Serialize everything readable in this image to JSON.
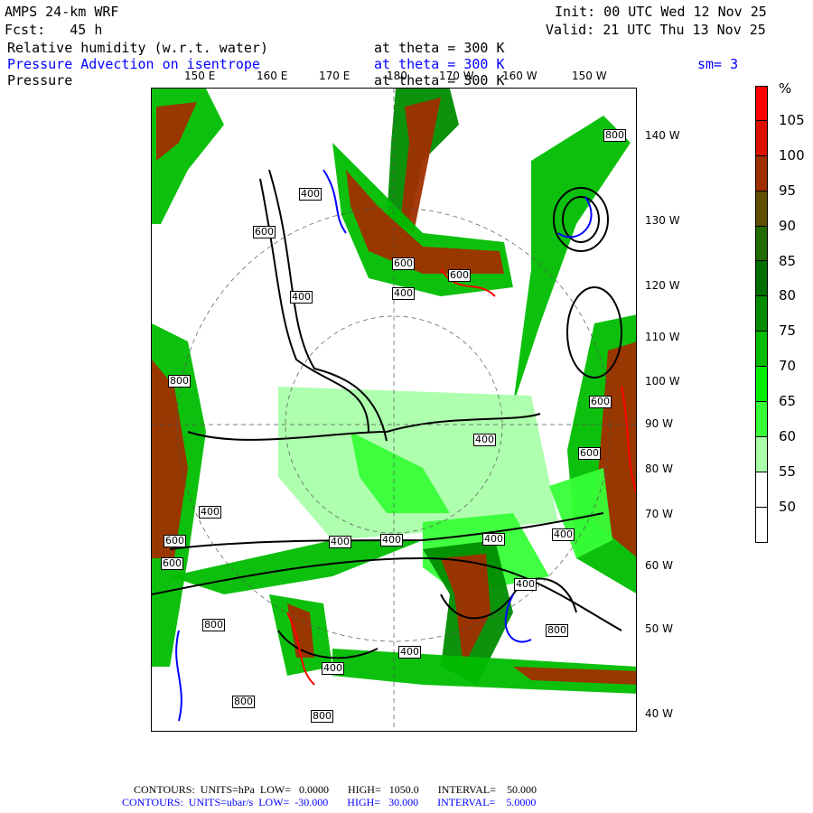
{
  "header": {
    "model": "AMPS 24-km WRF",
    "fcst": "Fcst:   45 h",
    "init": "Init: 00 UTC Wed 12 Nov 25",
    "valid": "Valid: 21 UTC Thu 13 Nov 25",
    "field1": "Relative humidity (w.r.t. water)",
    "field1_level": "at theta = 300 K",
    "field2": "Pressure Advection on isentrope",
    "field2_level": "at theta = 300 K",
    "smoothing": "sm= 3",
    "field3": "Pressure",
    "field3_level": "at theta = 300 K"
  },
  "map": {
    "top_lon_labels": [
      "150 E",
      "160 E",
      "170 E",
      "180",
      "170 W",
      "160 W",
      "150 W"
    ],
    "right_lon_labels": [
      "140 W",
      "130 W",
      "120 W",
      "110 W",
      "100 W",
      "90 W",
      "80 W",
      "70 W",
      "60 W",
      "50 W",
      "40 W"
    ],
    "contour_labels": [
      "800",
      "400",
      "600",
      "600",
      "600",
      "400",
      "400",
      "800",
      "600",
      "400",
      "600",
      "400",
      "600",
      "600",
      "400",
      "400",
      "400",
      "400",
      "400",
      "800",
      "800",
      "400",
      "400",
      "800",
      "800"
    ]
  },
  "colorbar": {
    "unit": "%",
    "labels": [
      "105",
      "100",
      "95",
      "90",
      "85",
      "80",
      "75",
      "70",
      "65",
      "60",
      "55",
      "50"
    ],
    "colors": [
      "#ff0000",
      "#dd1000",
      "#a02f00",
      "#604f00",
      "#1f6b00",
      "#006f00",
      "#008c00",
      "#00bd00",
      "#00ef00",
      "#37ff37",
      "#aaffaa",
      "#ffffff",
      "#ffffff"
    ]
  },
  "footer": {
    "line1": "CONTOURS:  UNITS=hPa  LOW=   0.0000       HIGH=   1050.0       INTERVAL=    50.000",
    "line2": "CONTOURS:  UNITS=ubar/s  LOW=  -30.000       HIGH=   30.000       INTERVAL=    5.0000"
  }
}
